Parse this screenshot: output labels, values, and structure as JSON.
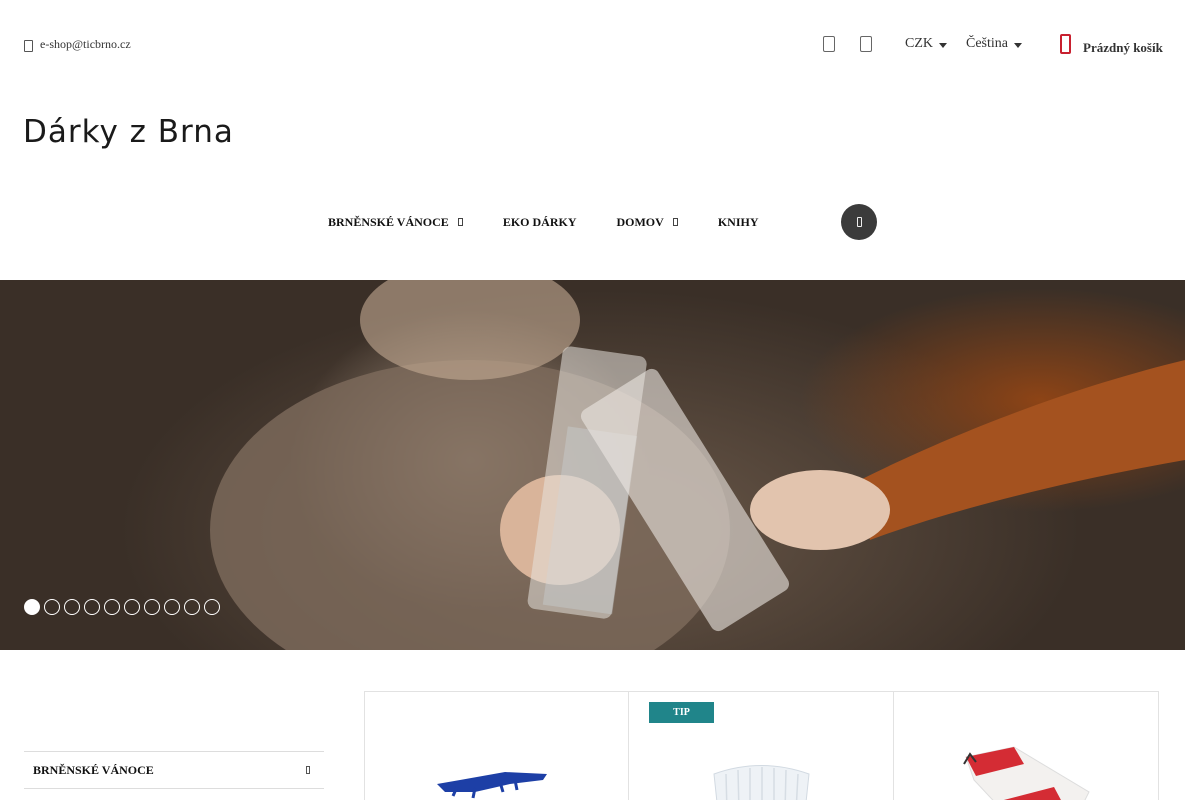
{
  "topbar": {
    "email": "e-shop@ticbrno.cz",
    "currency": "CZK",
    "language": "Čeština",
    "cart_label": "Prázdný košík",
    "icons": [
      "phone-icon",
      "user-icon",
      "cart-icon"
    ],
    "cart_color": "#c8202f"
  },
  "logo": {
    "text": "Dárky z Brna"
  },
  "nav": {
    "items": [
      {
        "label": "BRNĚNSKÉ VÁNOCE",
        "has_submenu": true
      },
      {
        "label": "EKO DÁRKY",
        "has_submenu": false
      },
      {
        "label": "DOMOV",
        "has_submenu": true
      },
      {
        "label": "KNIHY",
        "has_submenu": false
      }
    ],
    "search_icon": "search-icon"
  },
  "hero": {
    "slide_count": 10,
    "active_slide": 1
  },
  "sidebar": {
    "items": [
      {
        "label": "BRNĚNSKÉ VÁNOCE"
      }
    ]
  },
  "products": [
    {
      "badge": "",
      "image": "blue crocodile figure"
    },
    {
      "badge": "TIP",
      "image": "white ribbed cup"
    },
    {
      "badge": "",
      "image": "white and red Brno socks"
    }
  ],
  "colors": {
    "tip_badge": "#20858a",
    "search_button": "#3b3b3b"
  }
}
